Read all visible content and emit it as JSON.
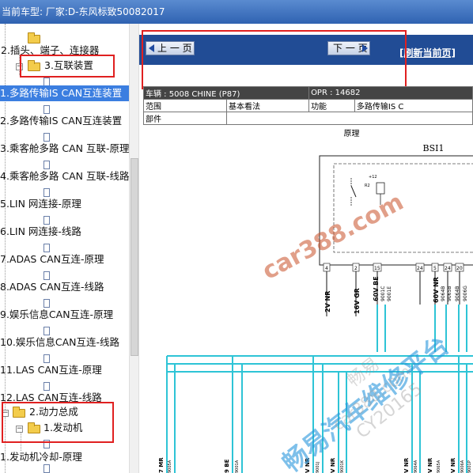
{
  "window": {
    "title": "当前车型:  厂家:D-东风标致50082017"
  },
  "tree": {
    "items": [
      {
        "label": "",
        "icon": "folder-icon"
      },
      {
        "label": "2.插头、端子、连接器",
        "icon": ""
      },
      {
        "label": "3.互联装置",
        "icon": "folder-icon"
      },
      {
        "label": "",
        "icon": "doc-icon"
      },
      {
        "label": "1.多路传输IS CAN互连装置",
        "icon": "",
        "selected": true
      },
      {
        "label": "",
        "icon": "doc-icon"
      },
      {
        "label": "2.多路传输IS CAN互连装置",
        "icon": ""
      },
      {
        "label": "",
        "icon": "doc-icon"
      },
      {
        "label": "3.乘客舱多路 CAN 互联-原理",
        "icon": ""
      },
      {
        "label": "",
        "icon": "doc-icon"
      },
      {
        "label": "4.乘客舱多路 CAN 互联-线路",
        "icon": ""
      },
      {
        "label": "",
        "icon": "doc-icon"
      },
      {
        "label": "5.LIN 网连接-原理",
        "icon": ""
      },
      {
        "label": "",
        "icon": "doc-icon"
      },
      {
        "label": "6.LIN 网连接-线路",
        "icon": ""
      },
      {
        "label": "",
        "icon": "doc-icon"
      },
      {
        "label": "7.ADAS CAN互连-原理",
        "icon": ""
      },
      {
        "label": "",
        "icon": "doc-icon"
      },
      {
        "label": "8.ADAS CAN互连-线路",
        "icon": ""
      },
      {
        "label": "",
        "icon": "doc-icon"
      },
      {
        "label": "9.娱乐信息CAN互连-原理",
        "icon": ""
      },
      {
        "label": "",
        "icon": "doc-icon"
      },
      {
        "label": "10.娱乐信息CAN互连-线路",
        "icon": ""
      },
      {
        "label": "",
        "icon": "doc-icon"
      },
      {
        "label": "11.LAS CAN互连-原理",
        "icon": ""
      },
      {
        "label": "",
        "icon": "doc-icon"
      },
      {
        "label": "12.LAS CAN互连-线路",
        "icon": ""
      },
      {
        "label": "2.动力总成",
        "icon": "folder-icon"
      },
      {
        "label": "1.发动机",
        "icon": "folder-icon"
      },
      {
        "label": "",
        "icon": "doc-icon"
      },
      {
        "label": "1.发动机冷却-原理",
        "icon": ""
      },
      {
        "label": "",
        "icon": "doc-icon"
      }
    ]
  },
  "viewer": {
    "prev_label": "上 一 页",
    "next_label": "下 一 页",
    "refresh_label": "[刷新当前页]",
    "doc_header": {
      "vehicle": "车辆 : 5008 CHINE (P87)",
      "opr": "OPR : 14682",
      "scope_label": "范围",
      "scope_value": "基本看法",
      "function_label": "功能",
      "function_value": "多路传输IS C",
      "parts_label": "部件",
      "subtitle": "原理"
    },
    "schematic": {
      "component": "BSI1",
      "pin_labels": [
        "2V NR",
        "16V GR",
        "60V BE",
        "60V NR"
      ],
      "wire_codes": [
        "9001C",
        "9001E",
        "9064B",
        "9065B",
        "9064B",
        "9006G"
      ],
      "pin_numbers": [
        "4",
        "2",
        "15",
        "24",
        "5",
        "24",
        "20"
      ],
      "relay_label": "+12",
      "relay_id": "R2",
      "bottom_labels": [
        "7 MR",
        "9 BE",
        "V NR",
        "V NR",
        "V NR",
        "V NR",
        "V NR"
      ],
      "bottom_codes": [
        "9005A",
        "9001A",
        "9001J",
        "9001K",
        "9064A",
        "9065A",
        "9006A",
        "9001P"
      ]
    }
  },
  "watermarks": [
    "car388.com",
    "畅易汽车维修平台",
    "畅易",
    "CY20165",
    "car388.com"
  ]
}
